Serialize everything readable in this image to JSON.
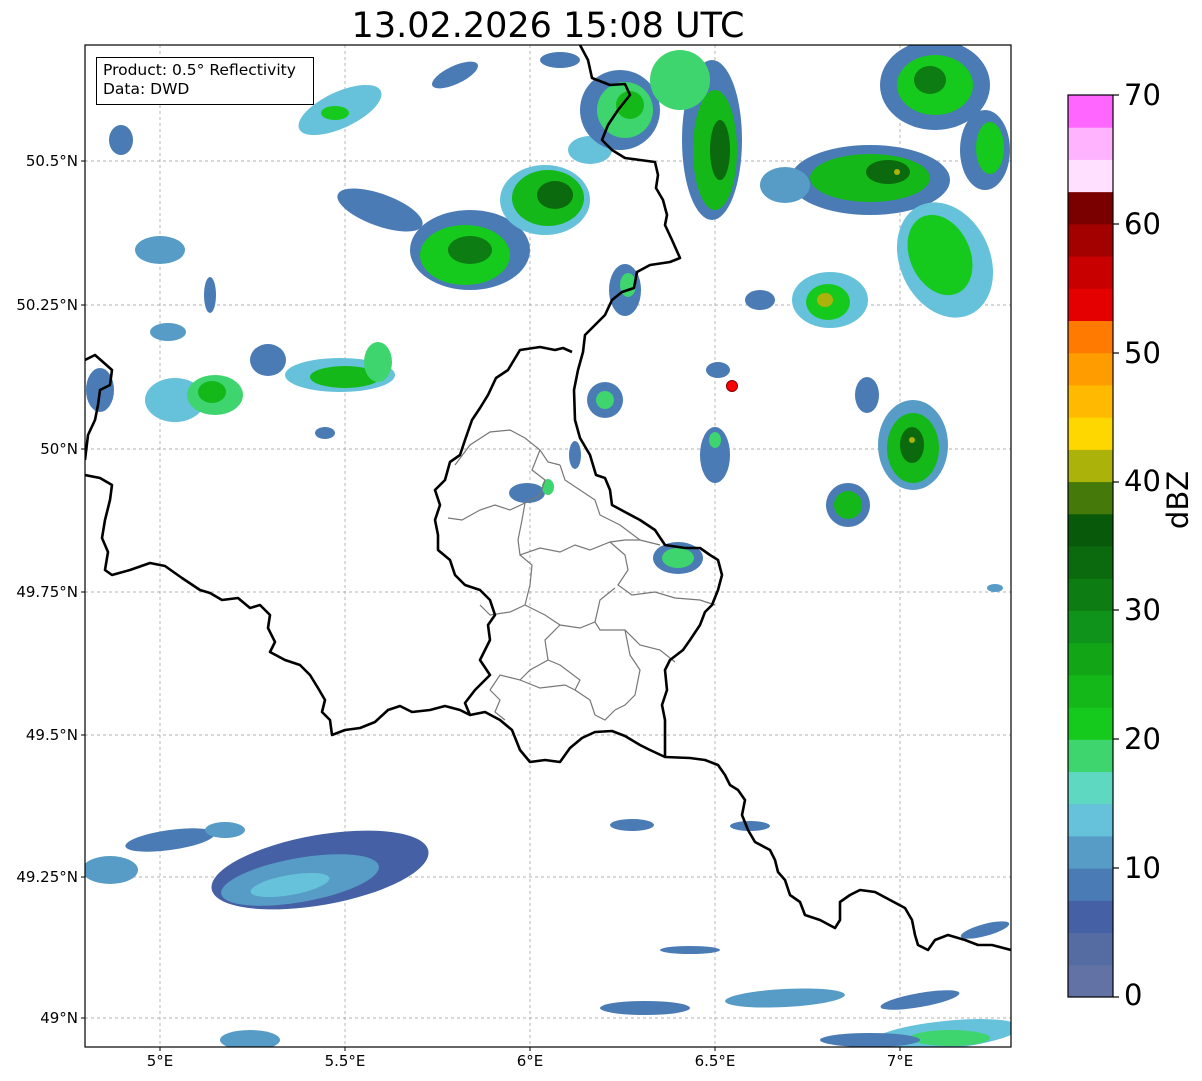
{
  "title": "13.02.2026 15:08 UTC",
  "info_box": {
    "product_line": "Product: 0.5° Reflectivity",
    "data_line": "Data: DWD"
  },
  "axes": {
    "lon_labels": [
      "5°E",
      "5.5°E",
      "6°E",
      "6.5°E",
      "7°E"
    ],
    "lat_labels": [
      "50.5°N",
      "50.25°N",
      "50°N",
      "49.75°N",
      "49.5°N",
      "49.25°N",
      "49°N"
    ],
    "lon_range": [
      4.8,
      7.3
    ],
    "lat_range": [
      48.95,
      50.7
    ],
    "grid": true
  },
  "colorbar": {
    "label": "dBZ",
    "tick_labels": [
      "0",
      "10",
      "20",
      "30",
      "40",
      "50",
      "60",
      "70"
    ],
    "range": [
      0,
      70
    ],
    "step": 2.5,
    "colors": [
      "#6272a4",
      "#546ca2",
      "#4660a5",
      "#4a7bb5",
      "#579cc6",
      "#66c2da",
      "#5fd8c2",
      "#3ed56e",
      "#16c91d",
      "#14b818",
      "#12a616",
      "#10931a",
      "#0d7c12",
      "#0a6a0d",
      "#085a0a",
      "#457a0a",
      "#abb209",
      "#ffd700",
      "#ffba00",
      "#ff9c00",
      "#ff7a00",
      "#e50000",
      "#c80000",
      "#a30000",
      "#7a0000",
      "#ffe0ff",
      "#ffb3ff",
      "#ff66ff",
      "#ee33ee"
    ]
  },
  "radar_site": {
    "lon": 6.55,
    "lat": 50.11,
    "color": "#ff0000"
  }
}
